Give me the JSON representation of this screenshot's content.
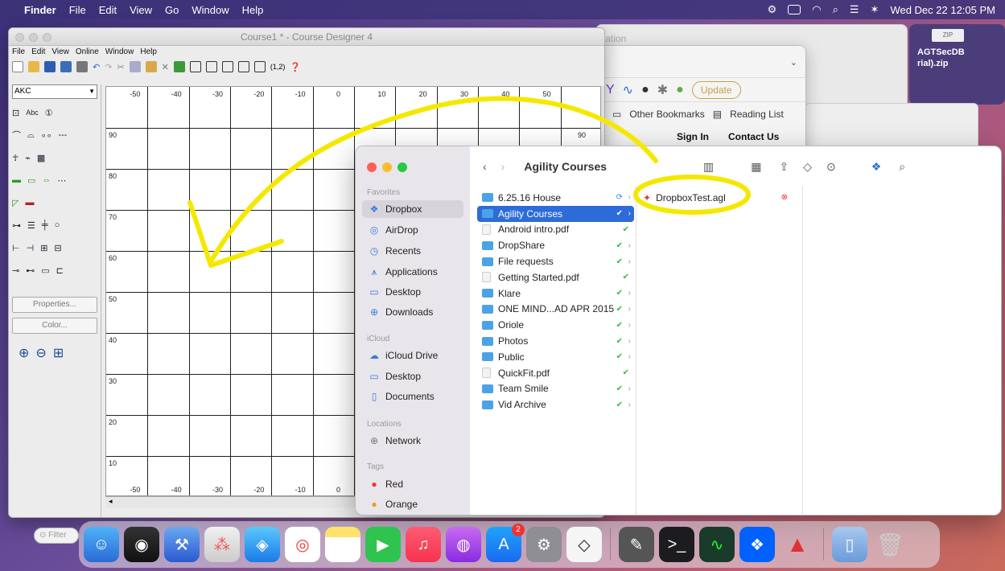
{
  "menubar": {
    "app": "Finder",
    "items": [
      "File",
      "Edit",
      "View",
      "Go",
      "Window",
      "Help"
    ],
    "clock": "Wed Dec 22  12:05 PM"
  },
  "zip": {
    "label": "ZIP",
    "name_line1": "AGTSecDB",
    "name_line2": "rial).zip"
  },
  "course_designer": {
    "title": "Course1 * - Course Designer 4",
    "menu": [
      "File",
      "Edit",
      "View",
      "Online",
      "Window",
      "Help"
    ],
    "org_select": "AKC",
    "properties_btn": "Properties...",
    "color_btn": "Color...",
    "x_ticks": [
      "-50",
      "-40",
      "-30",
      "-20",
      "-10",
      "0",
      "10",
      "20",
      "30",
      "40",
      "50"
    ],
    "y_ticks": [
      "90",
      "80",
      "70",
      "60",
      "50",
      "40",
      "30",
      "20",
      "10"
    ],
    "right_tick": "90",
    "bottom_ticks": [
      "-50",
      "-40",
      "-30",
      "-20",
      "-10",
      "0"
    ]
  },
  "browser": {
    "tab_partial": "tation",
    "update_btn": "Update",
    "bookmark_other": "Other Bookmarks",
    "bookmark_reading": "Reading List",
    "sign_in": "Sign In",
    "contact": "Contact Us"
  },
  "finder": {
    "title": "Agility Courses",
    "sections": {
      "favorites": "Favorites",
      "icloud": "iCloud",
      "locations": "Locations",
      "tags": "Tags"
    },
    "favorites": [
      "Dropbox",
      "AirDrop",
      "Recents",
      "Applications",
      "Desktop",
      "Downloads"
    ],
    "icloud": [
      "iCloud Drive",
      "Desktop",
      "Documents"
    ],
    "locations": [
      "Network"
    ],
    "tags": [
      "Red",
      "Orange"
    ],
    "col1": [
      {
        "name": "6.25.16 House",
        "type": "folder",
        "status": "blue",
        "chev": true
      },
      {
        "name": "Agility Courses",
        "type": "folder",
        "status": "green",
        "chev": true,
        "selected": true
      },
      {
        "name": "Android intro.pdf",
        "type": "doc",
        "status": "green",
        "chev": false
      },
      {
        "name": "DropShare",
        "type": "folder",
        "status": "green",
        "chev": true
      },
      {
        "name": "File requests",
        "type": "folder",
        "status": "green",
        "chev": true
      },
      {
        "name": "Getting Started.pdf",
        "type": "doc",
        "status": "green",
        "chev": false
      },
      {
        "name": "Klare",
        "type": "folder",
        "status": "green",
        "chev": true
      },
      {
        "name": "ONE MIND...AD APR 2015",
        "type": "folder",
        "status": "green",
        "chev": true
      },
      {
        "name": "Oriole",
        "type": "folder",
        "status": "green",
        "chev": true
      },
      {
        "name": "Photos",
        "type": "folder",
        "status": "green",
        "chev": true
      },
      {
        "name": "Public",
        "type": "folder",
        "status": "green",
        "chev": true
      },
      {
        "name": "QuickFit.pdf",
        "type": "doc",
        "status": "green",
        "chev": false
      },
      {
        "name": "Team Smile",
        "type": "folder",
        "status": "green",
        "chev": true
      },
      {
        "name": "Vid Archive",
        "type": "folder",
        "status": "green",
        "chev": true
      }
    ],
    "col2": [
      {
        "name": "DropboxTest.agl",
        "status": "error"
      }
    ]
  },
  "dock": {
    "filter_placeholder": "Filter",
    "appstore_badge": "2"
  },
  "colors": {
    "annotation": "#f5e800",
    "finder_selected": "#2d6cd8",
    "sync_green": "#2fb94a"
  }
}
